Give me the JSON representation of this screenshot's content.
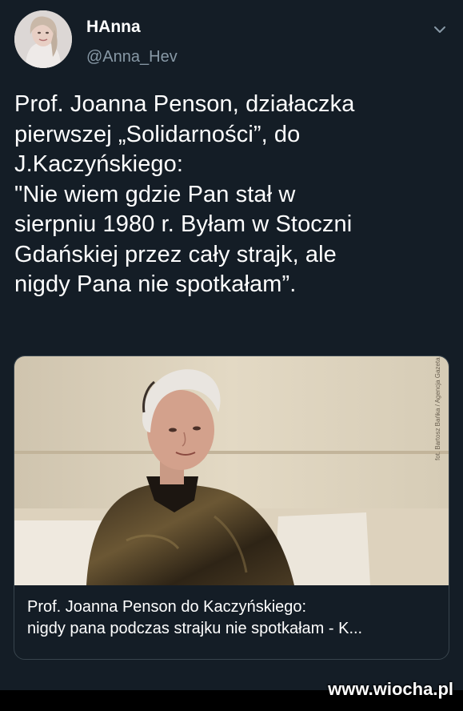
{
  "author": {
    "name": "HAnna",
    "handle": "@Anna_Hev"
  },
  "tweet": {
    "text": "Prof. Joanna Penson, działaczka\npierwszej „Solidarności”,  do\nJ.Kaczyńskiego:\n\"Nie wiem gdzie Pan stał w\nsierpniu 1980 r. Byłam w Stoczni\nGdańskiej przez cały strajk, ale\nnigdy Pana nie spotkałam”."
  },
  "card": {
    "title_line1": "Prof. Joanna Penson do Kaczyńskiego:",
    "title_line2": "nigdy pana podczas strajku nie spotkałam - K...",
    "photo_credit": "fot. Bartosz Bańka / Agencja Gazeta"
  },
  "watermark": "www.wiocha.pl",
  "icons": {
    "menu": "chevron-down-icon",
    "avatar": "profile-avatar"
  },
  "colors": {
    "background": "#141d26",
    "secondary_text": "#8899a6",
    "card_border": "#38444d"
  }
}
